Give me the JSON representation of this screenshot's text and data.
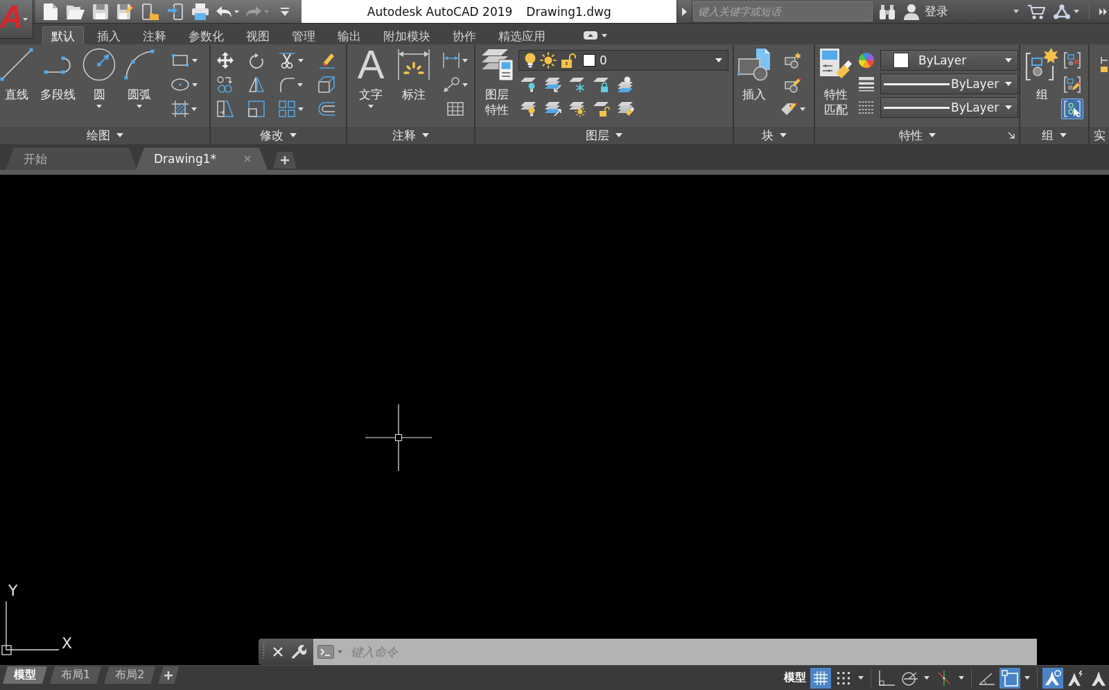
{
  "title_bar": {
    "app_logo": "A",
    "quick_access": [
      {
        "kind": "new",
        "disabled": false,
        "dropdown": false
      },
      {
        "kind": "open",
        "disabled": false,
        "dropdown": false
      },
      {
        "kind": "save",
        "disabled": false,
        "dropdown": false
      },
      {
        "kind": "save_as",
        "disabled": false,
        "dropdown": false
      },
      {
        "kind": "open_web",
        "disabled": false,
        "dropdown": false
      },
      {
        "kind": "save_web",
        "disabled": false,
        "dropdown": false
      },
      {
        "kind": "plot",
        "disabled": false,
        "dropdown": false
      },
      {
        "kind": "undo",
        "disabled": false,
        "dropdown": true
      },
      {
        "kind": "redo",
        "disabled": true,
        "dropdown": true
      },
      {
        "kind": "customize",
        "disabled": false,
        "dropdown": false
      }
    ],
    "app_name": "Autodesk AutoCAD 2019",
    "file_name": "Drawing1.dwg",
    "search": {
      "placeholder": "键入关键字或短语"
    },
    "sign_in": "登录"
  },
  "ribbon_tabs": [
    {
      "label": "默认",
      "selected": true
    },
    {
      "label": "插入",
      "selected": false
    },
    {
      "label": "注释",
      "selected": false
    },
    {
      "label": "参数化",
      "selected": false
    },
    {
      "label": "视图",
      "selected": false
    },
    {
      "label": "管理",
      "selected": false
    },
    {
      "label": "输出",
      "selected": false
    },
    {
      "label": "附加模块",
      "selected": false
    },
    {
      "label": "协作",
      "selected": false
    },
    {
      "label": "精选应用",
      "selected": false
    }
  ],
  "ribbon_panels": [
    {
      "kind": "draw",
      "title": "绘图",
      "dropdown": true,
      "launcher": false,
      "large_tools": [
        {
          "kind": "line",
          "label": "直线",
          "dropdown": false
        },
        {
          "kind": "polyline",
          "label": "多段线",
          "dropdown": false
        },
        {
          "kind": "circle",
          "label": "圆",
          "dropdown": true
        },
        {
          "kind": "arc",
          "label": "圆弧",
          "dropdown": true
        }
      ],
      "small_tools": [
        {
          "kind": "rectangle",
          "dropdown": true
        },
        {
          "kind": "ellipse",
          "dropdown": true
        },
        {
          "kind": "hatch",
          "dropdown": true
        }
      ]
    },
    {
      "kind": "modify",
      "title": "修改",
      "dropdown": true,
      "launcher": false,
      "small_tools": [
        {
          "kind": "move",
          "dropdown": false
        },
        {
          "kind": "rotate",
          "dropdown": false
        },
        {
          "kind": "trim",
          "dropdown": true
        },
        {
          "kind": "erase",
          "dropdown": false
        },
        {
          "kind": "copy",
          "dropdown": false
        },
        {
          "kind": "mirror",
          "dropdown": false
        },
        {
          "kind": "fillet",
          "dropdown": true
        },
        {
          "kind": "explode",
          "dropdown": false
        },
        {
          "kind": "stretch",
          "dropdown": false
        },
        {
          "kind": "scale",
          "dropdown": false
        },
        {
          "kind": "array",
          "dropdown": true
        },
        {
          "kind": "offset",
          "dropdown": false
        }
      ]
    },
    {
      "kind": "annotation",
      "title": "注释",
      "dropdown": true,
      "launcher": false,
      "large_tools": [
        {
          "kind": "text",
          "glyph": "A",
          "label": "文字",
          "dropdown": true
        },
        {
          "kind": "dimension",
          "label": "标注",
          "dropdown": false
        }
      ],
      "small_tools": [
        {
          "kind": "linear_dimension",
          "dropdown": true
        },
        {
          "kind": "leader",
          "dropdown": true
        },
        {
          "kind": "table",
          "dropdown": false
        }
      ]
    },
    {
      "kind": "layers",
      "title": "图层",
      "dropdown": true,
      "launcher": false,
      "large_tools": [
        {
          "kind": "layer_properties",
          "label": "图层特性",
          "dropdown": false
        }
      ],
      "current_layer": {
        "name": "0",
        "on": true,
        "frozen": false,
        "locked": false
      },
      "small_tools": [
        {
          "kind": "layer_off",
          "dropdown": false
        },
        {
          "kind": "layer_match",
          "dropdown": false
        },
        {
          "kind": "layer_freeze",
          "dropdown": false
        },
        {
          "kind": "layer_lock",
          "dropdown": false
        },
        {
          "kind": "layer_current",
          "dropdown": false
        },
        {
          "kind": "layer_on",
          "dropdown": false
        },
        {
          "kind": "layer_copy",
          "dropdown": false
        },
        {
          "kind": "layer_thaw",
          "dropdown": false
        },
        {
          "kind": "layer_unlock",
          "dropdown": false
        },
        {
          "kind": "layer_brush",
          "dropdown": false
        }
      ]
    },
    {
      "kind": "block",
      "title": "块",
      "dropdown": true,
      "launcher": false,
      "large_tools": [
        {
          "kind": "insert",
          "label": "插入",
          "dropdown": false
        }
      ],
      "small_tools": [
        {
          "kind": "create_block",
          "dropdown": false
        },
        {
          "kind": "edit_block",
          "dropdown": false
        },
        {
          "kind": "edit_attribute",
          "dropdown": true
        }
      ]
    },
    {
      "kind": "properties",
      "title": "特性",
      "dropdown": true,
      "launcher": true,
      "large_tools": [
        {
          "kind": "match_properties",
          "label": "特性匹配",
          "dropdown": false
        }
      ],
      "small_tools": [
        {
          "kind": "color",
          "dropdown": false
        },
        {
          "kind": "lineweight",
          "dropdown": false
        },
        {
          "kind": "linetype",
          "dropdown": false
        }
      ],
      "dropdowns": [
        {
          "kind": "color",
          "value": "ByLayer"
        },
        {
          "kind": "lineweight",
          "value": "ByLayer"
        },
        {
          "kind": "linetype",
          "value": "ByLayer"
        }
      ]
    },
    {
      "kind": "groups",
      "title": "组",
      "dropdown": true,
      "launcher": false,
      "large_tools": [
        {
          "kind": "group",
          "label": "组",
          "dropdown": false
        }
      ],
      "small_tools": [
        {
          "kind": "ungroup",
          "on": false,
          "dropdown": false
        },
        {
          "kind": "group_edit",
          "on": false,
          "dropdown": false
        },
        {
          "kind": "group_select",
          "on": true,
          "dropdown": false
        }
      ]
    },
    {
      "kind": "utilities",
      "title": "实",
      "dropdown": false,
      "launcher": false,
      "large_tools": [
        {
          "kind": "measure",
          "dropdown": false
        }
      ]
    }
  ],
  "document_tabs": [
    {
      "label": "开始",
      "selected": false,
      "closable": false
    },
    {
      "label": "Drawing1*",
      "selected": true,
      "closable": true
    }
  ],
  "canvas": {
    "ucs": {
      "y_label": "Y",
      "x_label": "X"
    }
  },
  "command_line": {
    "placeholder": "键入命令"
  },
  "status_bar": {
    "layout_tabs": [
      {
        "label": "模型",
        "selected": true
      },
      {
        "label": "布局1",
        "selected": false
      },
      {
        "label": "布局2",
        "selected": false
      }
    ],
    "space_label": "模型",
    "toggles": [
      {
        "kind": "grid",
        "on": true,
        "dropdown": false
      },
      {
        "kind": "snap",
        "on": false,
        "dropdown": true
      },
      {
        "kind": "ortho",
        "on": false,
        "dropdown": false
      },
      {
        "kind": "polar_tracking",
        "on": false,
        "dropdown": true
      },
      {
        "kind": "isometric",
        "on": false,
        "dropdown": true
      },
      {
        "kind": "object_tracking",
        "on": false,
        "dropdown": false
      },
      {
        "kind": "object_snap",
        "on": true,
        "dropdown": true
      },
      {
        "kind": "annotation_visibility",
        "on": true,
        "dropdown": false
      },
      {
        "kind": "autoscale",
        "on": false,
        "dropdown": false
      },
      {
        "kind": "annotation_scale",
        "on": false,
        "dropdown": false
      }
    ]
  }
}
